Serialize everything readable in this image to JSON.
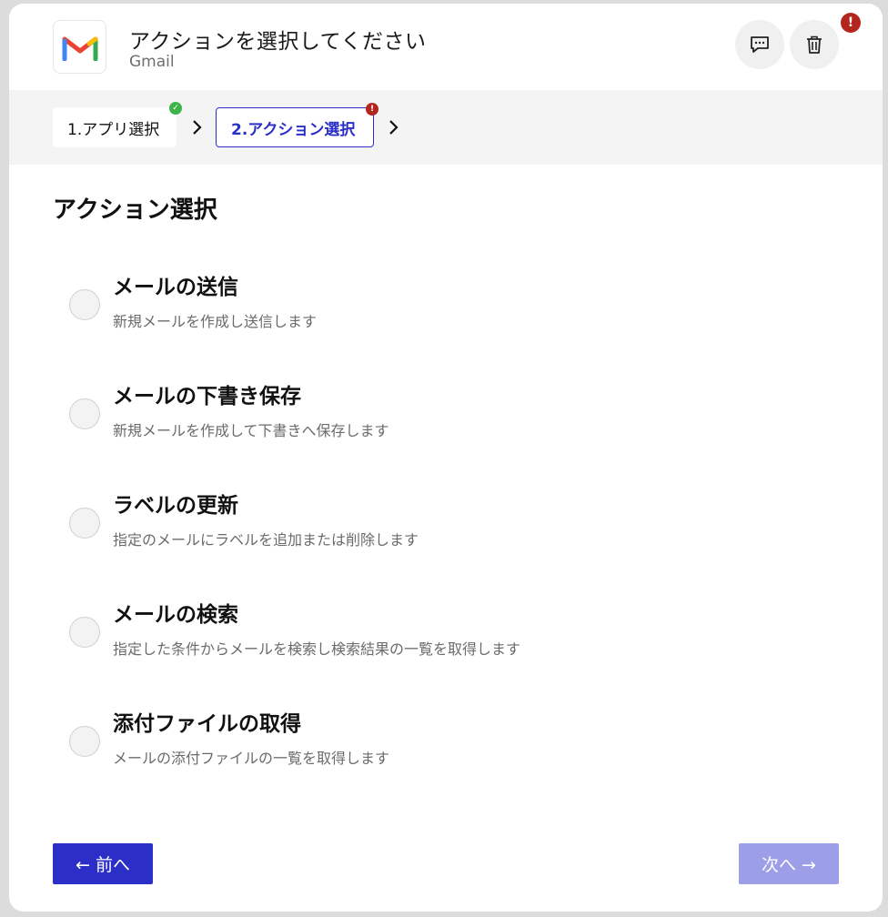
{
  "header": {
    "title": "アクションを選択してください",
    "subtitle": "Gmail",
    "error_badge": "!"
  },
  "icons": {
    "logo": "gmail-logo-icon",
    "comment": "comment-icon",
    "trash": "trash-icon",
    "chevron": "chevron-right-icon"
  },
  "colors": {
    "accent": "#2b2fc8",
    "accent_disabled": "#9c9ee8",
    "success": "#3cb44a",
    "error": "#b3261e"
  },
  "steps": [
    {
      "label": "1.アプリ選択",
      "status": "complete"
    },
    {
      "label": "2.アクション選択",
      "status": "error"
    }
  ],
  "section": {
    "title": "アクション選択"
  },
  "options": [
    {
      "title": "メールの送信",
      "desc": "新規メールを作成し送信します"
    },
    {
      "title": "メールの下書き保存",
      "desc": "新規メールを作成して下書きへ保存します"
    },
    {
      "title": "ラベルの更新",
      "desc": "指定のメールにラベルを追加または削除します"
    },
    {
      "title": "メールの検索",
      "desc": "指定した条件からメールを検索し検索結果の一覧を取得します"
    },
    {
      "title": "添付ファイルの取得",
      "desc": "メールの添付ファイルの一覧を取得します"
    }
  ],
  "footer": {
    "prev_label": "← 前へ",
    "next_label": "次へ →"
  }
}
